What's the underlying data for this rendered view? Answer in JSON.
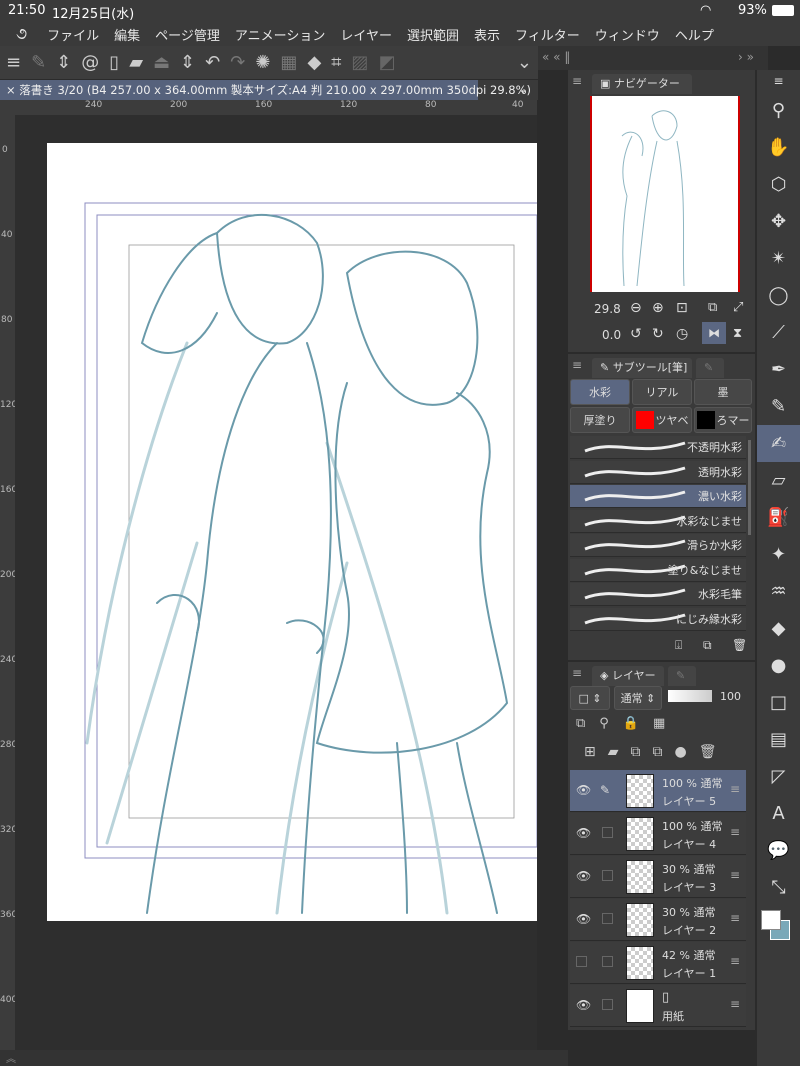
{
  "status": {
    "time": "21:50",
    "date": "12月25日(水)",
    "battery": "93%"
  },
  "menu": [
    "ファイル",
    "編集",
    "ページ管理",
    "アニメーション",
    "レイヤー",
    "選択範囲",
    "表示",
    "フィルター",
    "ウィンドウ",
    "ヘルプ"
  ],
  "doc_tab": "落書き 3/20 (B4 257.00 x 364.00mm 製本サイズ:A4 判 210.00 x 297.00mm 350dpi 29.8%)",
  "ruler_top": [
    "240",
    "200",
    "160",
    "120",
    "80",
    "40"
  ],
  "ruler_left": [
    "0",
    "40",
    "80",
    "120",
    "160",
    "200",
    "240",
    "280",
    "320",
    "360",
    "400"
  ],
  "navigator": {
    "tab": "ナビゲーター",
    "zoom": "29.8",
    "rotation": "0.0"
  },
  "subtool": {
    "tab": "サブツール[筆]",
    "groups": [
      "水彩",
      "リアル",
      "墨",
      "厚塗り",
      "ツヤベ",
      "ろマー"
    ],
    "brushes": [
      "不透明水彩",
      "透明水彩",
      "濃い水彩",
      "水彩なじませ",
      "滑らか水彩",
      "塗り&なじませ",
      "水彩毛筆",
      "にじみ縁水彩"
    ],
    "selected": "濃い水彩"
  },
  "layers": {
    "tab": "レイヤー",
    "blend": "通常",
    "opacity": "100",
    "items": [
      {
        "info": "100 % 通常",
        "name": "レイヤー 5",
        "visible": true,
        "selected": true
      },
      {
        "info": "100 % 通常",
        "name": "レイヤー 4",
        "visible": true
      },
      {
        "info": "30 % 通常",
        "name": "レイヤー 3",
        "visible": true
      },
      {
        "info": "30 % 通常",
        "name": "レイヤー 2",
        "visible": true
      },
      {
        "info": "42 % 通常",
        "name": "レイヤー 1",
        "visible": false
      },
      {
        "info": "",
        "name": "用紙",
        "visible": true
      }
    ]
  },
  "colors": {
    "accent": "#5b6782",
    "sketch": "#6a9aaa",
    "main_color": "#ffffff",
    "sub_color": "#7aa8b8"
  }
}
